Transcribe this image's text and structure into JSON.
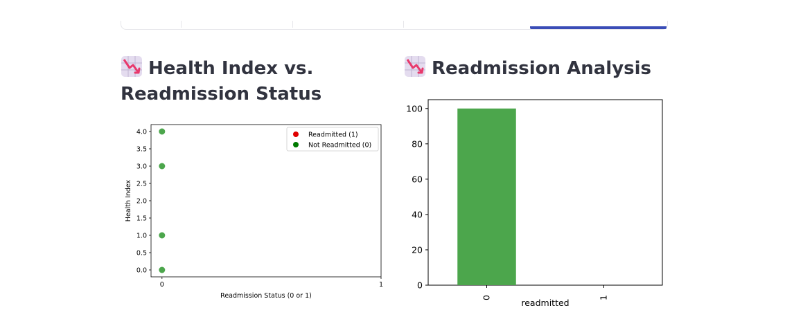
{
  "tabs": {
    "labels": [
      "",
      "",
      "",
      "",
      ""
    ],
    "active_index": 4,
    "active_color": "#3a4db7"
  },
  "left": {
    "icon": "chart-decreasing-icon",
    "title_line1": "Health Index vs.",
    "title_line2": "Readmission Status"
  },
  "right": {
    "icon": "chart-decreasing-icon",
    "title": "Readmission Analysis"
  },
  "chart_data": [
    {
      "type": "scatter",
      "title": "",
      "xlabel": "Readmission Status (0 or 1)",
      "ylabel": "Health Index",
      "xlim": [
        -0.05,
        1.0
      ],
      "ylim": [
        -0.2,
        4.2
      ],
      "xticks": [
        "0",
        "1"
      ],
      "yticks": [
        "0.0",
        "0.5",
        "1.0",
        "1.5",
        "2.0",
        "2.5",
        "3.0",
        "3.5",
        "4.0"
      ],
      "legend": {
        "placement": "top-right",
        "entries": [
          {
            "name": "Readmitted (1)",
            "color": "#e00000"
          },
          {
            "name": "Not Readmitted (0)",
            "color": "#007a00"
          }
        ]
      },
      "series": [
        {
          "name": "Not Readmitted (0)",
          "color": "#4ca64c",
          "points": [
            [
              0,
              4.0
            ],
            [
              0,
              3.0
            ],
            [
              0,
              1.0
            ],
            [
              0,
              0.0
            ]
          ]
        },
        {
          "name": "Readmitted (1)",
          "color": "#e00000",
          "points": []
        }
      ]
    },
    {
      "type": "bar",
      "title": "",
      "xlabel": "readmitted",
      "ylabel": "",
      "categories": [
        "0",
        "1"
      ],
      "values": [
        100,
        0
      ],
      "ylim": [
        0,
        105
      ],
      "yticks": [
        "0",
        "20",
        "40",
        "60",
        "80",
        "100"
      ],
      "color": "#4ca64c"
    }
  ]
}
